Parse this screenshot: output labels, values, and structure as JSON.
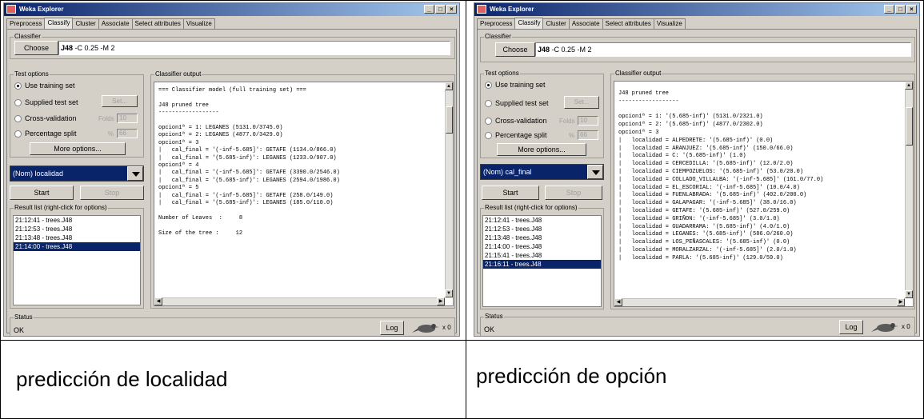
{
  "left": {
    "window_title": "Weka Explorer",
    "tabs": [
      "Preprocess",
      "Classify",
      "Cluster",
      "Associate",
      "Select attributes",
      "Visualize"
    ],
    "classifier_group": "Classifier",
    "choose_button": "Choose",
    "classifier_name": "J48",
    "classifier_args": "-C 0.25 -M 2",
    "test_options_group": "Test options",
    "opt_training": "Use training set",
    "opt_supplied": "Supplied test set",
    "set_button": "Set...",
    "opt_cv": "Cross-validation",
    "folds_label": "Folds",
    "folds_value": "10",
    "opt_split": "Percentage split",
    "pct_label": "%",
    "pct_value": "66",
    "more_options": "More options...",
    "target_attribute": "(Nom) localidad",
    "start_button": "Start",
    "stop_button": "Stop",
    "result_list_group": "Result list (right-click for options)",
    "results": [
      "21:12:41 - trees.J48",
      "21:12:53 - trees.J48",
      "21:13:48 - trees.J48",
      "21:14:00 - trees.J48"
    ],
    "output_group": "Classifier output",
    "output_lines": [
      "=== Classifier model (full training set) ===",
      "",
      "J48 pruned tree",
      "------------------",
      "",
      "opcion1ª = 1: LEGANES (5131.0/3745.0)",
      "opcion1ª = 2: LEGANES (4877.0/3429.0)",
      "opcion1ª = 3",
      "|   cal_final = '(-inf-5.685]': GETAFE (1134.0/866.0)",
      "|   cal_final = '(5.685-inf)': LEGANES (1233.0/907.0)",
      "opcion1ª = 4",
      "|   cal_final = '(-inf-5.685]': GETAFE (3390.0/2546.0)",
      "|   cal_final = '(5.685-inf)': LEGANES (2594.0/1986.0)",
      "opcion1ª = 5",
      "|   cal_final = '(-inf-5.685]': GETAFE (258.0/149.0)",
      "|   cal_final = '(5.685-inf)': LEGANES (185.0/110.0)",
      "",
      "Number of Leaves  :     8",
      "",
      "Size of the tree :     12"
    ],
    "status_group": "Status",
    "status_text": "OK",
    "log_button": "Log",
    "x_count": "x 0",
    "caption": "predicción de localidad"
  },
  "right": {
    "window_title": "Weka Explorer",
    "tabs": [
      "Preprocess",
      "Classify",
      "Cluster",
      "Associate",
      "Select attributes",
      "Visualize"
    ],
    "classifier_group": "Classifier",
    "choose_button": "Choose",
    "classifier_name": "J48",
    "classifier_args": "-C 0.25 -M 2",
    "test_options_group": "Test options",
    "opt_training": "Use training set",
    "opt_supplied": "Supplied test set",
    "set_button": "Set...",
    "opt_cv": "Cross-validation",
    "folds_label": "Folds",
    "folds_value": "10",
    "opt_split": "Percentage split",
    "pct_label": "%",
    "pct_value": "66",
    "more_options": "More options...",
    "target_attribute": "(Nom) cal_final",
    "start_button": "Start",
    "stop_button": "Stop",
    "result_list_group": "Result list (right-click for options)",
    "results": [
      "21:12:41 - trees.J48",
      "21:12:53 - trees.J48",
      "21:13:48 - trees.J48",
      "21:14:00 - trees.J48",
      "21:15:41 - trees.J48",
      "21:16:11 - trees.J48"
    ],
    "output_group": "Classifier output",
    "output_lines": [
      "J48 pruned tree",
      "------------------",
      "",
      "opcion1ª = 1: '(5.685-inf)' (5131.0/2321.0)",
      "opcion1ª = 2: '(5.685-inf)' (4877.0/2302.0)",
      "opcion1ª = 3",
      "|   localidad = ALPEDRETE: '(5.685-inf)' (0.0)",
      "|   localidad = ARANJUEZ: '(5.685-inf)' (150.0/66.0)",
      "|   localidad = C: '(5.685-inf)' (1.0)",
      "|   localidad = CERCEDILLA: '(5.685-inf)' (12.0/2.0)",
      "|   localidad = CIEMPOZUELOS: '(5.685-inf)' (53.0/20.0)",
      "|   localidad = COLLADO_VILLALBA: '(-inf-5.685]' (161.0/77.0)",
      "|   localidad = EL_ESCORIAL: '(-inf-5.685]' (10.0/4.0)",
      "|   localidad = FUENLABRADA: '(5.685-inf)' (402.0/200.0)",
      "|   localidad = GALAPAGAR: '(-inf-5.685]' (38.0/16.0)",
      "|   localidad = GETAFE: '(5.685-inf)' (527.0/259.0)",
      "|   localidad = GRIÑON: '(-inf-5.685]' (3.0/1.0)",
      "|   localidad = GUADARRAMA: '(5.685-inf)' (4.0/1.0)",
      "|   localidad = LEGANES: '(5.685-inf)' (586.0/260.0)",
      "|   localidad = LOS_PEÑASCALES: '(5.685-inf)' (0.0)",
      "|   localidad = MORALZARZAL: '(-inf-5.685]' (2.0/1.0)",
      "|   localidad = PARLA: '(5.685-inf)' (129.0/59.0)"
    ],
    "status_group": "Status",
    "status_text": "OK",
    "log_button": "Log",
    "x_count": "x 0",
    "caption": "predicción de opción"
  },
  "colors": {
    "title_gradient_start": "#0a246a",
    "title_gradient_end": "#a6caf0",
    "window_face": "#d4d0c8",
    "selection": "#0a246a"
  }
}
